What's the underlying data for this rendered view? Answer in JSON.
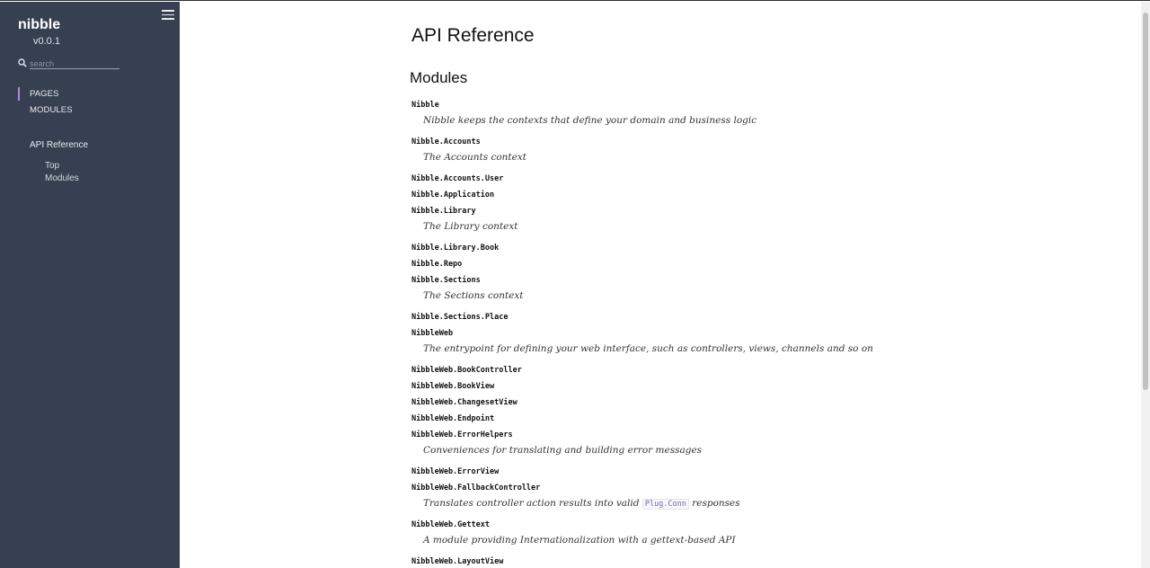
{
  "sidebar": {
    "project": "nibble",
    "version": "v0.0.1",
    "search_placeholder": "search",
    "nav_types": [
      "PAGES",
      "MODULES"
    ],
    "page": "API Reference",
    "subsections": [
      "Top",
      "Modules"
    ]
  },
  "content": {
    "title": "API Reference",
    "section": "Modules",
    "modules": [
      {
        "name": "Nibble",
        "desc": "Nibble keeps the contexts that define your domain and business logic"
      },
      {
        "name": "Nibble.Accounts",
        "desc": "The Accounts context"
      },
      {
        "name": "Nibble.Accounts.User",
        "desc": ""
      },
      {
        "name": "Nibble.Application",
        "desc": ""
      },
      {
        "name": "Nibble.Library",
        "desc": "The Library context"
      },
      {
        "name": "Nibble.Library.Book",
        "desc": ""
      },
      {
        "name": "Nibble.Repo",
        "desc": ""
      },
      {
        "name": "Nibble.Sections",
        "desc": "The Sections context"
      },
      {
        "name": "Nibble.Sections.Place",
        "desc": ""
      },
      {
        "name": "NibbleWeb",
        "desc": "The entrypoint for defining your web interface, such as controllers, views, channels and so on"
      },
      {
        "name": "NibbleWeb.BookController",
        "desc": ""
      },
      {
        "name": "NibbleWeb.BookView",
        "desc": ""
      },
      {
        "name": "NibbleWeb.ChangesetView",
        "desc": ""
      },
      {
        "name": "NibbleWeb.Endpoint",
        "desc": ""
      },
      {
        "name": "NibbleWeb.ErrorHelpers",
        "desc": "Conveniences for translating and building error messages"
      },
      {
        "name": "NibbleWeb.ErrorView",
        "desc": ""
      },
      {
        "name": "NibbleWeb.FallbackController",
        "desc_before": "Translates controller action results into valid",
        "desc_code": "Plug.Conn",
        "desc_after": "responses"
      },
      {
        "name": "NibbleWeb.Gettext",
        "desc": "A module providing Internationalization with a gettext-based API"
      },
      {
        "name": "NibbleWeb.LayoutView",
        "desc": ""
      }
    ]
  },
  "colors": {
    "sidebar_bg": "#374051",
    "accent": "#a78bda",
    "code": "#8266b8"
  }
}
